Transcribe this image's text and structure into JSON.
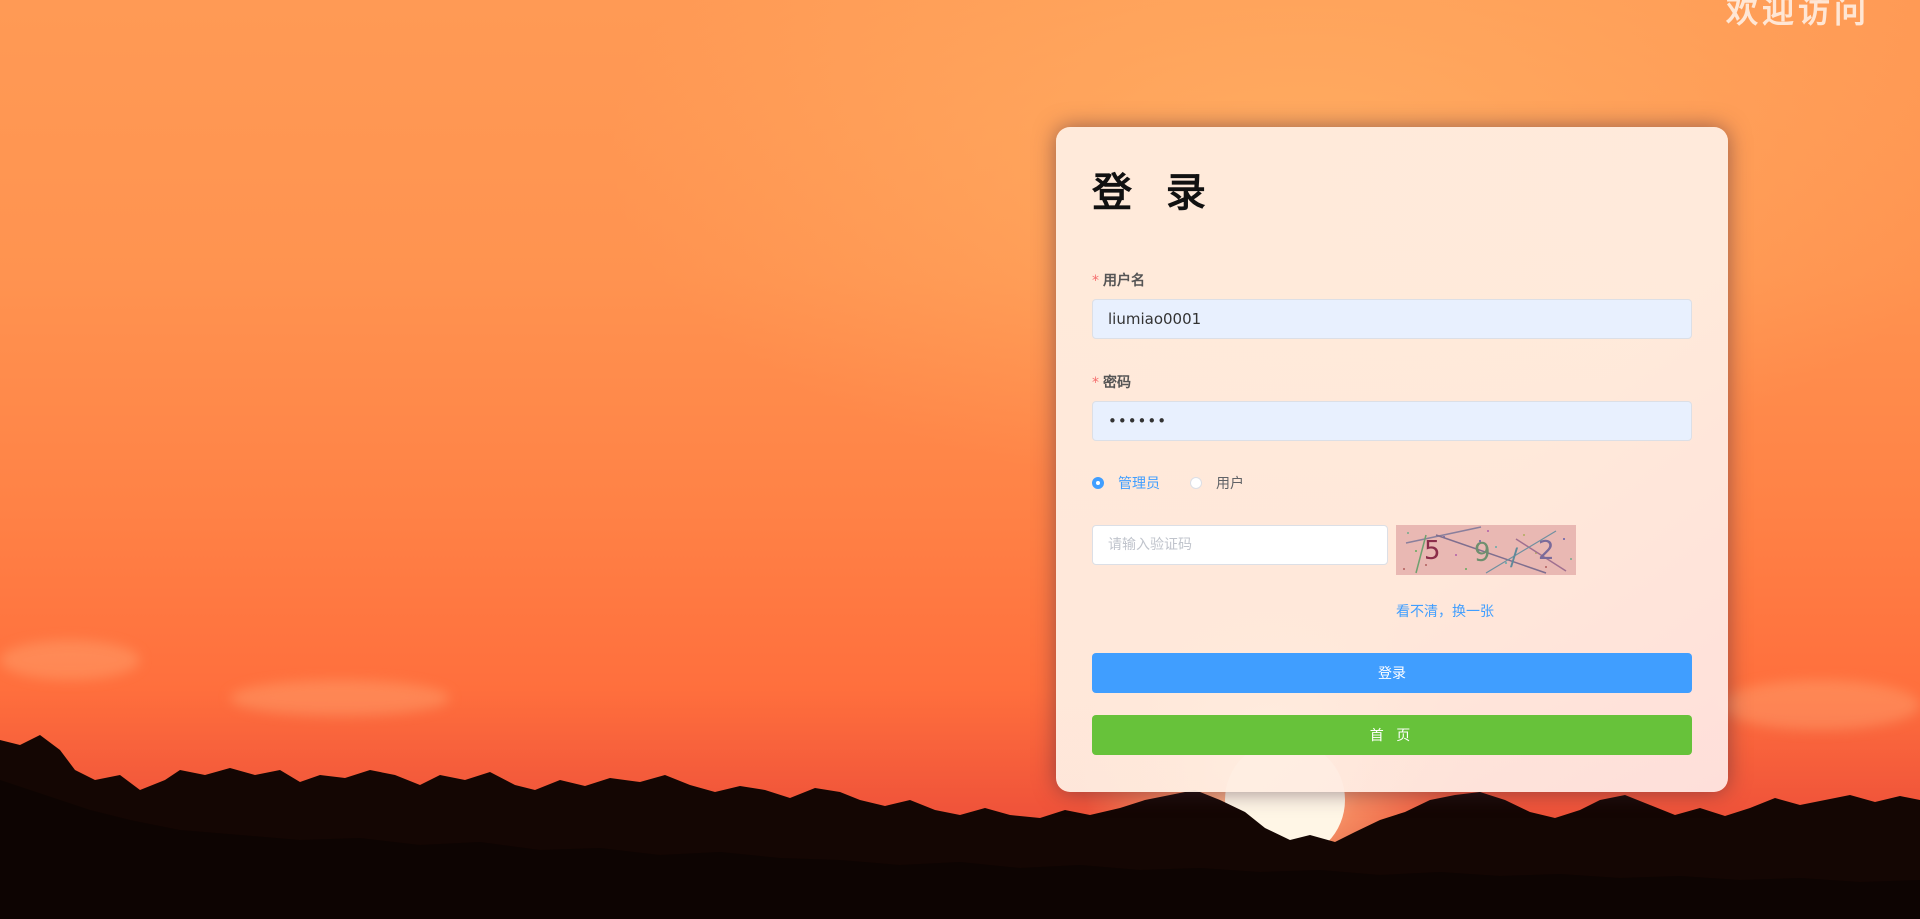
{
  "corner_text": "欢迎访问",
  "login": {
    "title": "登 录",
    "username_label": "用户名",
    "username_value": "liumiao0001",
    "password_label": "密码",
    "password_value": "••••••",
    "required_mark": "*",
    "role_options": [
      {
        "label": "管理员",
        "checked": true
      },
      {
        "label": "用户",
        "checked": false
      }
    ],
    "captcha_placeholder": "请输入验证码",
    "captcha_chars": [
      "5",
      "9",
      "/",
      "2"
    ],
    "captcha_refresh": "看不清，换一张",
    "login_button": "登录",
    "home_button": "首 页"
  },
  "colors": {
    "primary": "#409eff",
    "success": "#67c23a",
    "required": "#f56c6c"
  },
  "icons": {
    "radio_checked": "radio-checked-icon",
    "radio_unchecked": "radio-unchecked-icon"
  }
}
